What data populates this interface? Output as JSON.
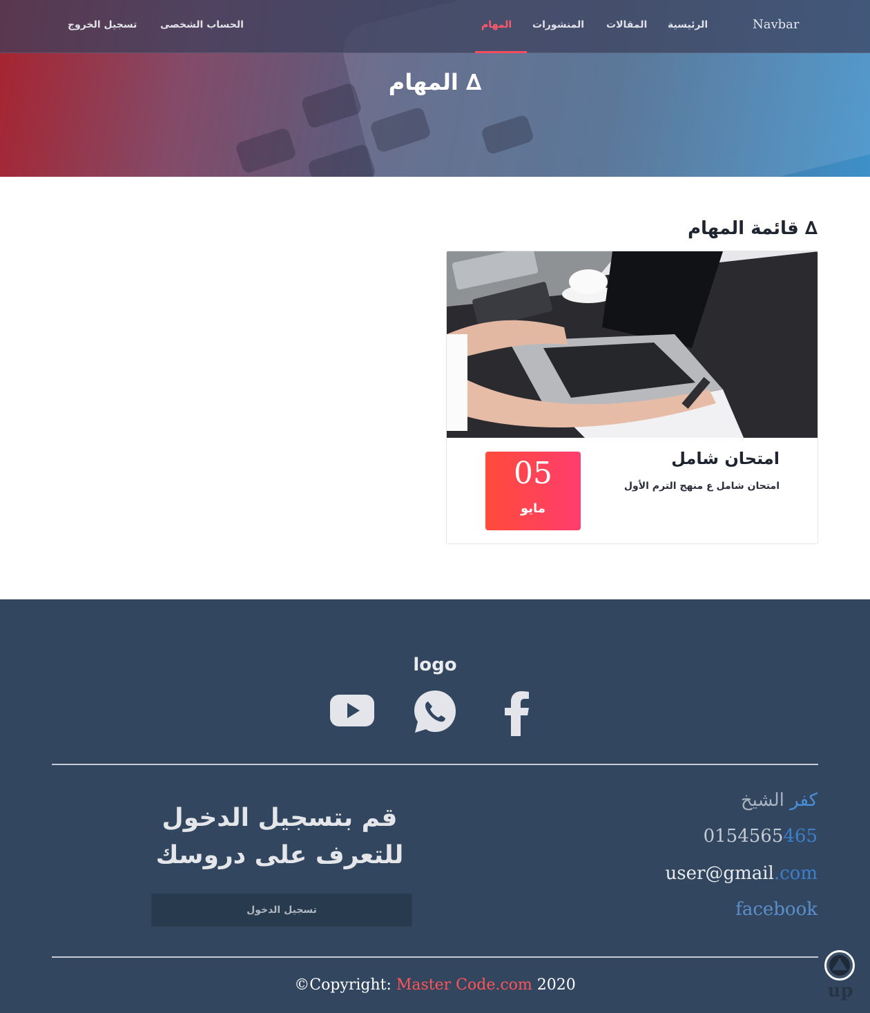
{
  "nav": {
    "brand": "Navbar",
    "items": [
      {
        "label": "الرئيسية",
        "active": false
      },
      {
        "label": "المقالات",
        "active": false
      },
      {
        "label": "المنشورات",
        "active": false
      },
      {
        "label": "المهام",
        "active": true
      }
    ],
    "profile": "الحساب الشخصى",
    "logout": "تسجيل الخروج"
  },
  "hero": {
    "title": "∆ المهام"
  },
  "main": {
    "section_title": "∆ قائمة المهام",
    "tasks": [
      {
        "title": "امتحان شامل",
        "description": "امتحان شامل ع منهج الترم الأول",
        "day": "05",
        "month": "مايو"
      }
    ]
  },
  "footer": {
    "logo": "logo",
    "social_icons": [
      "facebook-icon",
      "whatsapp-icon",
      "youtube-icon"
    ],
    "contact": {
      "address_a": "الشيخ",
      "address_b": "كفر",
      "phone_a": "0154565",
      "phone_b": "465",
      "email_a": "user@gmail",
      "email_b": ".com",
      "social_link": "facebook"
    },
    "cta_line1": "قم بتسجيل الدخول",
    "cta_line2": "للتعرف على دروسك",
    "login_button": "تسجيل الدخول",
    "copyright_prefix": "©Copyright: ",
    "copyright_brand": "Master Code.com",
    "copyright_year": " 2020",
    "up_label": "up"
  },
  "colors": {
    "accent": "#ff4d5e",
    "footer_bg": "#32475f",
    "link_blue": "#4a90d9"
  }
}
